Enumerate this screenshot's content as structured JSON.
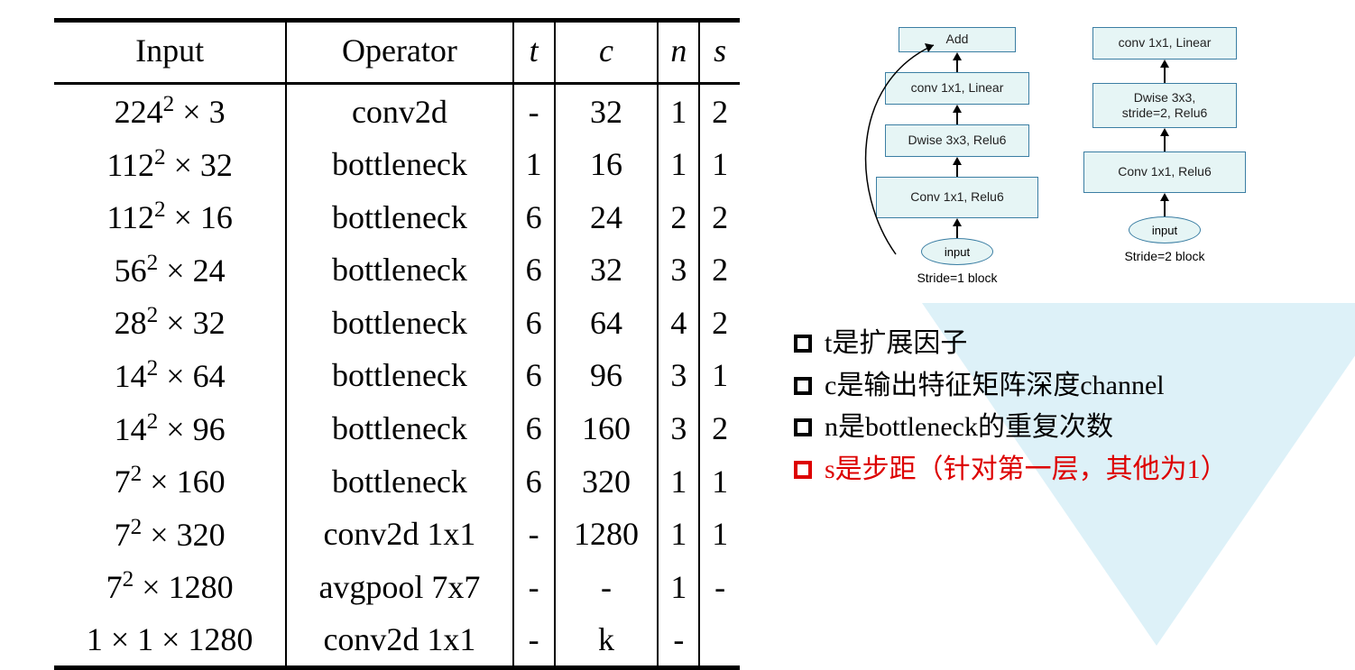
{
  "table": {
    "headers": {
      "input": "Input",
      "operator": "Operator",
      "t": "t",
      "c": "c",
      "n": "n",
      "s": "s"
    },
    "rows": [
      {
        "input_base": "224",
        "input_exp": "2",
        "input_ch": "3",
        "operator": "conv2d",
        "t": "-",
        "c": "32",
        "n": "1",
        "s": "2"
      },
      {
        "input_base": "112",
        "input_exp": "2",
        "input_ch": "32",
        "operator": "bottleneck",
        "t": "1",
        "c": "16",
        "n": "1",
        "s": "1"
      },
      {
        "input_base": "112",
        "input_exp": "2",
        "input_ch": "16",
        "operator": "bottleneck",
        "t": "6",
        "c": "24",
        "n": "2",
        "s": "2"
      },
      {
        "input_base": "56",
        "input_exp": "2",
        "input_ch": "24",
        "operator": "bottleneck",
        "t": "6",
        "c": "32",
        "n": "3",
        "s": "2"
      },
      {
        "input_base": "28",
        "input_exp": "2",
        "input_ch": "32",
        "operator": "bottleneck",
        "t": "6",
        "c": "64",
        "n": "4",
        "s": "2"
      },
      {
        "input_base": "14",
        "input_exp": "2",
        "input_ch": "64",
        "operator": "bottleneck",
        "t": "6",
        "c": "96",
        "n": "3",
        "s": "1"
      },
      {
        "input_base": "14",
        "input_exp": "2",
        "input_ch": "96",
        "operator": "bottleneck",
        "t": "6",
        "c": "160",
        "n": "3",
        "s": "2"
      },
      {
        "input_base": "7",
        "input_exp": "2",
        "input_ch": "160",
        "operator": "bottleneck",
        "t": "6",
        "c": "320",
        "n": "1",
        "s": "1"
      },
      {
        "input_base": "7",
        "input_exp": "2",
        "input_ch": "320",
        "operator": "conv2d 1x1",
        "t": "-",
        "c": "1280",
        "n": "1",
        "s": "1"
      },
      {
        "input_base": "7",
        "input_exp": "2",
        "input_ch": "1280",
        "operator": "avgpool 7x7",
        "t": "-",
        "c": "-",
        "n": "1",
        "s": "-"
      },
      {
        "input_plain": "1 × 1 × 1280",
        "operator": "conv2d 1x1",
        "t": "-",
        "c": "k",
        "n": "-",
        "s": ""
      }
    ]
  },
  "diagram": {
    "left": {
      "top": "Add",
      "b1": "conv 1x1, Linear",
      "b2": "Dwise 3x3, Relu6",
      "b3": "Conv 1x1, Relu6",
      "input": "input",
      "caption": "Stride=1 block"
    },
    "right": {
      "b0": "conv 1x1, Linear",
      "b1": "Dwise 3x3,\nstride=2, Relu6",
      "b2": "Conv 1x1, Relu6",
      "input": "input",
      "caption": "Stride=2 block"
    }
  },
  "bullets": {
    "b1": "t是扩展因子",
    "b2": "c是输出特征矩阵深度channel",
    "b3": "n是bottleneck的重复次数",
    "b4": "s是步距（针对第一层，其他为1）"
  }
}
